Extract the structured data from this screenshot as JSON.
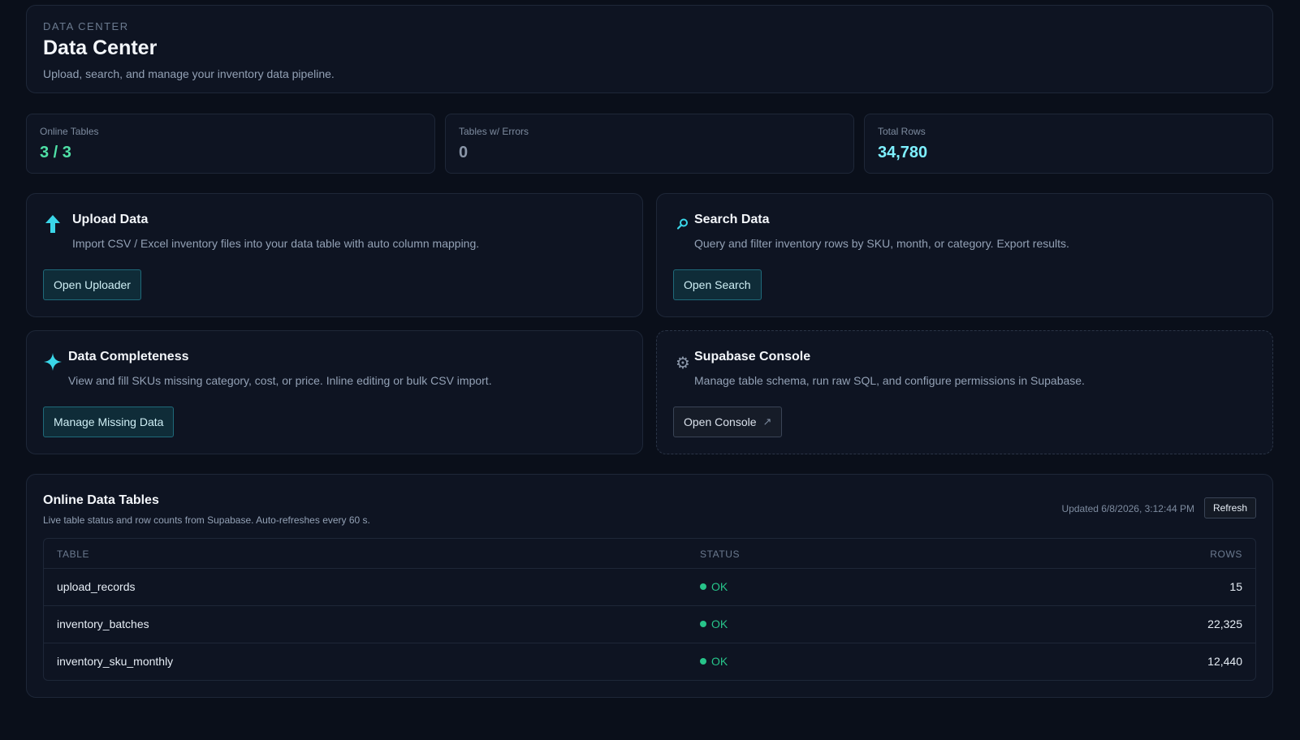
{
  "header": {
    "eyebrow": "DATA CENTER",
    "title": "Data Center",
    "subtitle": "Upload, search, and manage your inventory data pipeline."
  },
  "stats": [
    {
      "label": "Online Tables",
      "value": "3 / 3",
      "color": "#4fe0a6"
    },
    {
      "label": "Tables w/ Errors",
      "value": "0",
      "color": "#8a96a8"
    },
    {
      "label": "Total Rows",
      "value": "34,780",
      "color": "#7ef0ff"
    }
  ],
  "features": {
    "upload": {
      "icon": "upload-arrow-icon",
      "title": "Upload Data",
      "description": "Import CSV / Excel inventory files into your data table with auto column mapping.",
      "button": "Open Uploader"
    },
    "search": {
      "icon": "magnifier-icon",
      "title": "Search Data",
      "description": "Query and filter inventory rows by SKU, month, or category. Export results.",
      "button": "Open Search"
    },
    "completeness": {
      "icon": "sparkle-icon",
      "title": "Data Completeness",
      "description": "View and fill SKUs missing category, cost, or price. Inline editing or bulk CSV import.",
      "button": "Manage Missing Data"
    },
    "console": {
      "icon": "gear-icon",
      "title": "Supabase Console",
      "description": "Manage table schema, run raw SQL, and configure permissions in Supabase.",
      "button": "Open Console",
      "button_icon": "↗"
    }
  },
  "tables_panel": {
    "title": "Online Data Tables",
    "subtitle": "Live table status and row counts from Supabase. Auto-refreshes every 60 s.",
    "updated": "Updated 6/8/2026, 3:12:44 PM",
    "refresh_label": "Refresh",
    "columns": [
      "TABLE",
      "STATUS",
      "ROWS"
    ],
    "rows": [
      {
        "table": "upload_records",
        "status": "OK",
        "rows": "15"
      },
      {
        "table": "inventory_batches",
        "status": "OK",
        "rows": "22,325"
      },
      {
        "table": "inventory_sku_monthly",
        "status": "OK",
        "rows": "12,440"
      }
    ]
  }
}
